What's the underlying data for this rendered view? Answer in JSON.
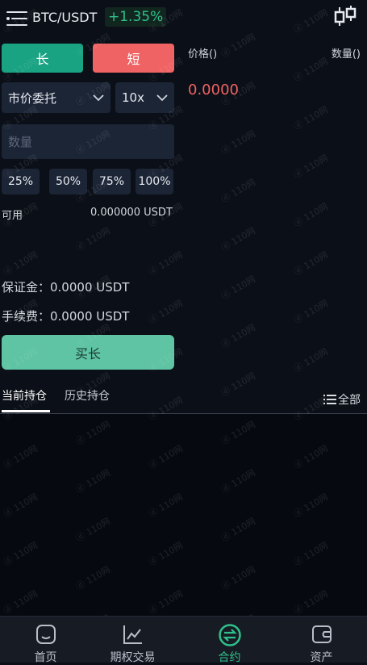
{
  "header": {
    "pair": "BTC/USDT",
    "change": "+1.35%",
    "menu_icon": "menu-icon",
    "chart_icon": "candlestick-icon"
  },
  "trade": {
    "long_label": "长",
    "short_label": "短",
    "order_type": "市价委托",
    "leverage": "10x",
    "qty_placeholder": "数量",
    "percents": [
      "25%",
      "50%",
      "75%",
      "100%"
    ],
    "available_label": "可用",
    "available_value": "0.000000 USDT",
    "margin_text": "保证金：0.0000 USDT",
    "fee_text": "手续费：0.0000 USDT",
    "buy_label": "买长"
  },
  "book": {
    "price_header": "价格()",
    "qty_header": "数量()",
    "price_value": "0.0000"
  },
  "tabs": {
    "current": "当前持仓",
    "history": "历史持仓",
    "all": "全部"
  },
  "nav": [
    {
      "label": "首页",
      "icon": "home-icon"
    },
    {
      "label": "期权交易",
      "icon": "chart-icon"
    },
    {
      "label": "合约",
      "icon": "swap-icon"
    },
    {
      "label": "资产",
      "icon": "wallet-icon"
    }
  ],
  "colors": {
    "long": "#1aa383",
    "short": "#f06364",
    "buy": "#5ec4a3",
    "active": "#2fc08b"
  },
  "watermark": "ⓓ 110网"
}
